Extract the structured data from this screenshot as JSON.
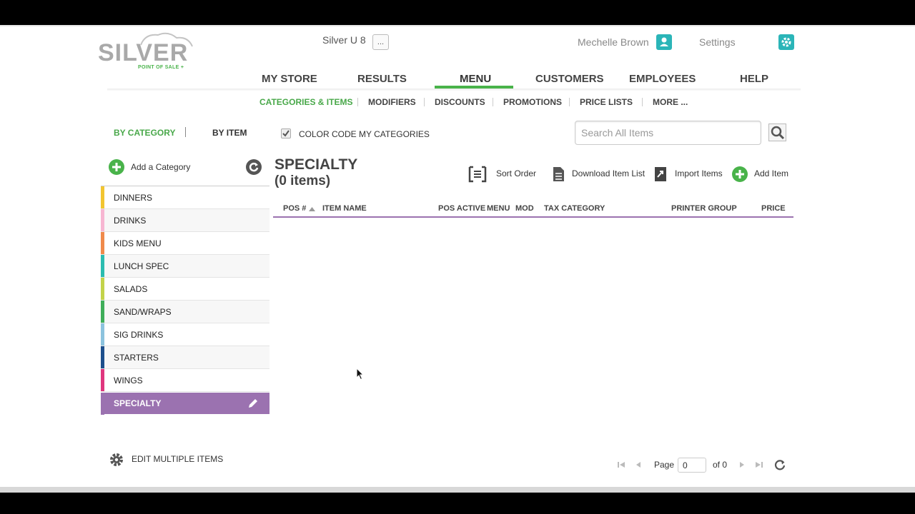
{
  "header": {
    "logo_word": "SILVER",
    "logo_sub": "POINT OF SALE +",
    "store_name": "Silver U 8",
    "store_more": "...",
    "user_name": "Mechelle Brown",
    "settings_label": "Settings"
  },
  "mainnav": [
    {
      "label": "MY STORE"
    },
    {
      "label": "RESULTS"
    },
    {
      "label": "MENU"
    },
    {
      "label": "CUSTOMERS"
    },
    {
      "label": "EMPLOYEES"
    },
    {
      "label": "HELP"
    }
  ],
  "mainnav_active": "MENU",
  "subnav": [
    {
      "label": "CATEGORIES & ITEMS"
    },
    {
      "label": "MODIFIERS"
    },
    {
      "label": "DISCOUNTS"
    },
    {
      "label": "PROMOTIONS"
    },
    {
      "label": "PRICE LISTS"
    },
    {
      "label": "MORE ..."
    }
  ],
  "subnav_active": "CATEGORIES & ITEMS",
  "view_tabs": {
    "by_category": "BY CATEGORY",
    "by_item": "BY ITEM"
  },
  "color_code_label": "COLOR CODE MY CATEGORIES",
  "color_code_checked": true,
  "add_category_label": "Add a Category",
  "categories": [
    {
      "label": "DINNERS",
      "color": "#f2c530"
    },
    {
      "label": "DRINKS",
      "color": "#f7b6d2"
    },
    {
      "label": "KIDS MENU",
      "color": "#f08a4b"
    },
    {
      "label": "LUNCH SPEC",
      "color": "#2bbcb0"
    },
    {
      "label": "SALADS",
      "color": "#c3d34a"
    },
    {
      "label": "SAND/WRAPS",
      "color": "#3fae5a"
    },
    {
      "label": "SIG DRINKS",
      "color": "#8cc3de"
    },
    {
      "label": "STARTERS",
      "color": "#1d4f8c"
    },
    {
      "label": "WINGS",
      "color": "#e0367e"
    },
    {
      "label": "SPECIALTY",
      "color": "#9b72b0",
      "selected": true
    }
  ],
  "search": {
    "placeholder": "Search All Items",
    "value": ""
  },
  "current_category": {
    "title": "SPECIALTY",
    "count_label": "(0 items)"
  },
  "actions": {
    "sort_order": "Sort Order",
    "download": "Download Item List",
    "import": "Import Items",
    "add_item": "Add Item"
  },
  "table": {
    "headers": [
      "POS #",
      "ITEM NAME",
      "POS ACTIVE",
      "MENU",
      "MOD",
      "TAX CATEGORY",
      "PRINTER GROUP",
      "PRICE"
    ],
    "rows": []
  },
  "edit_multiple_label": "EDIT MULTIPLE ITEMS",
  "pagination": {
    "page_label": "Page",
    "page_value": "0",
    "of_label": "of 0"
  },
  "colors": {
    "accent_green": "#49b34a",
    "accent_purple": "#9b72b0",
    "teal": "#2bb5b8"
  }
}
